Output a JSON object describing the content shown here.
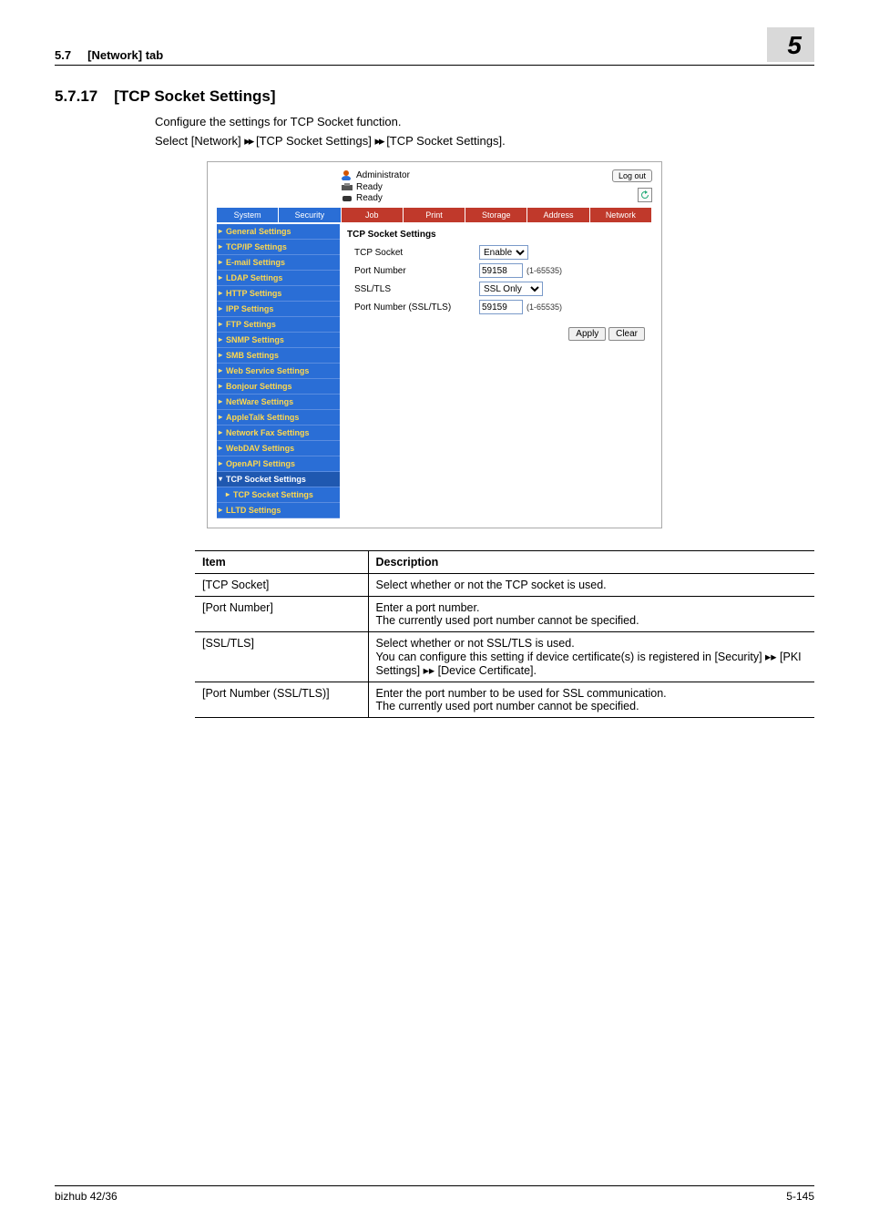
{
  "page": {
    "header_left_section": "5.7",
    "header_left_title": "[Network] tab",
    "header_right_chapter": "5",
    "section_number": "5.7.17",
    "section_title": "[TCP Socket Settings]",
    "intro_line": "Configure the settings for TCP Socket function.",
    "select_line_prefix": "Select [Network] ",
    "select_line_mid1": " [TCP Socket Settings] ",
    "select_line_mid2": " [TCP Socket Settings].",
    "arrows": "▸▸"
  },
  "figure": {
    "administrator_label": "Administrator",
    "ready_label": "Ready",
    "logout": "Log out",
    "tabs": [
      "System",
      "Security",
      "Job",
      "Print",
      "Storage",
      "Address",
      "Network"
    ],
    "sidebar": [
      "General Settings",
      "TCP/IP Settings",
      "E-mail Settings",
      "LDAP Settings",
      "HTTP Settings",
      "IPP Settings",
      "FTP Settings",
      "SNMP Settings",
      "SMB Settings",
      "Web Service Settings",
      "Bonjour Settings",
      "NetWare Settings",
      "AppleTalk Settings",
      "Network Fax Settings",
      "WebDAV Settings",
      "OpenAPI Settings"
    ],
    "sidebar_group": "TCP Socket Settings",
    "sidebar_sub": "TCP Socket Settings",
    "sidebar_after": [
      "LLTD Settings"
    ],
    "content_title": "TCP Socket Settings",
    "rows": {
      "tcp_socket": {
        "label": "TCP Socket",
        "value": "Enable"
      },
      "port": {
        "label": "Port Number",
        "value": "59158",
        "hint": "(1-65535)"
      },
      "ssl": {
        "label": "SSL/TLS",
        "value": "SSL Only"
      },
      "port_ssl": {
        "label": "Port Number (SSL/TLS)",
        "value": "59159",
        "hint": "(1-65535)"
      }
    },
    "apply": "Apply",
    "clear": "Clear"
  },
  "table": {
    "head_item": "Item",
    "head_desc": "Description",
    "rows": [
      {
        "item": "[TCP Socket]",
        "desc": "Select whether or not the TCP socket is used."
      },
      {
        "item": "[Port Number]",
        "desc": "Enter a port number.\nThe currently used port number cannot be specified."
      },
      {
        "item": "[SSL/TLS]",
        "desc": "Select whether or not SSL/TLS is used.\nYou can configure this setting if device certificate(s) is registered in [Security] ▸▸ [PKI Settings] ▸▸ [Device Certificate]."
      },
      {
        "item": "[Port Number (SSL/TLS)]",
        "desc": "Enter the port number to be used for SSL communication.\nThe currently used port number cannot be specified."
      }
    ]
  },
  "footer": {
    "left": "bizhub 42/36",
    "right": "5-145"
  }
}
